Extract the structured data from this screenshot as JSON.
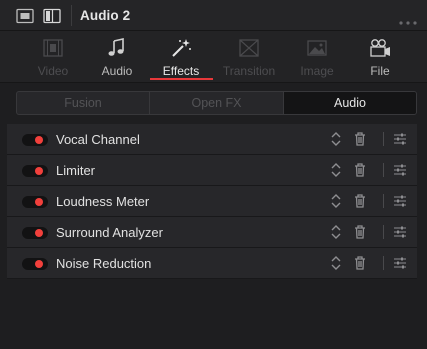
{
  "titlebar": {
    "title": "Audio 2",
    "icons": [
      "thumbnail-icon",
      "split-view-icon"
    ],
    "more_icon": "ellipsis-icon"
  },
  "tabs": [
    {
      "label": "Video",
      "icon": "film-frame-icon",
      "enabled": false,
      "active": false
    },
    {
      "label": "Audio",
      "icon": "music-note-icon",
      "enabled": true,
      "active": false
    },
    {
      "label": "Effects",
      "icon": "magic-wand-icon",
      "enabled": true,
      "active": true
    },
    {
      "label": "Transition",
      "icon": "transition-icon",
      "enabled": false,
      "active": false
    },
    {
      "label": "Image",
      "icon": "image-icon",
      "enabled": false,
      "active": false
    },
    {
      "label": "File",
      "icon": "film-camera-icon",
      "enabled": true,
      "active": false
    }
  ],
  "segments": [
    {
      "label": "Fusion",
      "active": false
    },
    {
      "label": "Open FX",
      "active": false
    },
    {
      "label": "Audio",
      "active": true
    }
  ],
  "effects": [
    {
      "name": "Vocal Channel",
      "enabled": true
    },
    {
      "name": "Limiter",
      "enabled": true
    },
    {
      "name": "Loudness Meter",
      "enabled": true
    },
    {
      "name": "Surround Analyzer",
      "enabled": true
    },
    {
      "name": "Noise Reduction",
      "enabled": true
    }
  ],
  "colors": {
    "accent": "#e8383a",
    "background": "#1e1e20",
    "row": "#27272a"
  }
}
